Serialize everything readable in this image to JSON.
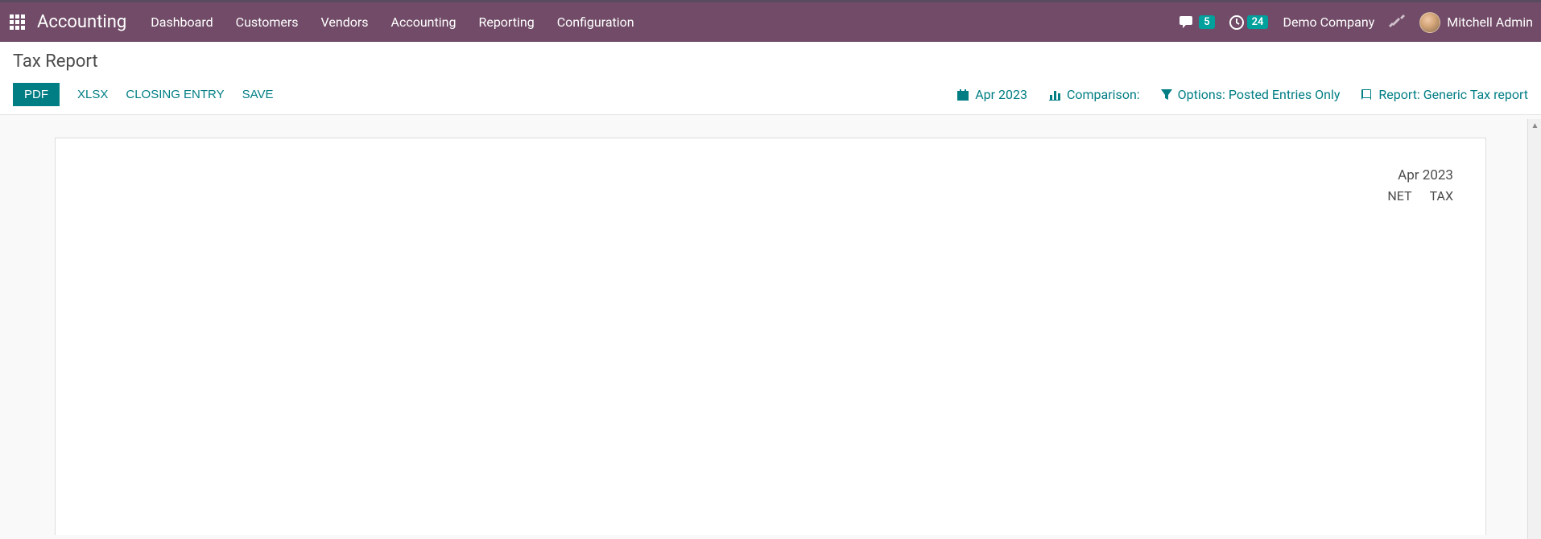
{
  "topbar": {
    "app_title": "Accounting",
    "menu": [
      "Dashboard",
      "Customers",
      "Vendors",
      "Accounting",
      "Reporting",
      "Configuration"
    ],
    "messages_badge": "5",
    "activities_badge": "24",
    "company": "Demo Company",
    "user": "Mitchell Admin"
  },
  "page": {
    "title": "Tax Report"
  },
  "actions": {
    "pdf": "PDF",
    "xlsx": "XLSX",
    "closing_entry": "CLOSING ENTRY",
    "save": "SAVE"
  },
  "filters": {
    "period": "Apr 2023",
    "comparison_label": "Comparison:",
    "options_label": "Options: Posted Entries Only",
    "report_label": "Report: Generic Tax report"
  },
  "report": {
    "period_header": "Apr 2023",
    "col_net": "NET",
    "col_tax": "TAX"
  }
}
